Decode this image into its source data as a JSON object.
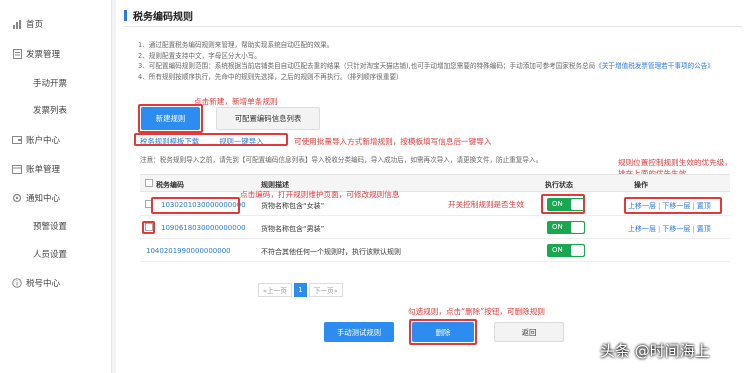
{
  "sidebar": {
    "items": [
      {
        "label": "首页",
        "icon": "bar-chart-icon"
      },
      {
        "label": "发票管理",
        "icon": "document-icon"
      },
      {
        "label": "手动开票"
      },
      {
        "label": "发票列表"
      },
      {
        "label": "账户中心",
        "icon": "wallet-icon"
      },
      {
        "label": "账单管理",
        "icon": "bill-icon"
      },
      {
        "label": "通知中心",
        "icon": "settings-icon"
      },
      {
        "label": "预警设置"
      },
      {
        "label": "人员设置"
      },
      {
        "label": "税号中心",
        "icon": "info-icon"
      }
    ]
  },
  "page": {
    "title": "税务编码规则",
    "notes": [
      "1、通过配置税务编码规则来管理，帮助实现系统自动匹配的效果。",
      "2、规则配置支持中文，字母区分大小写。",
      "3、可配置编码规则范围：系统根据当前店铺类目自动匹配去重的结果（只针对淘宝天猫店铺),也可手动增加您需要的特殊编码；手动添加可参考国家税务总局",
      "《关于增值税发票管理若干事项的公告》",
      "4、所有规则按顺序执行，先命中的规则先选择，之后的规则不再执行。（排列顺序很重要）"
    ],
    "btn_new": "新建规则",
    "btn_config_list": "可配置编码信息列表",
    "link_template": "税务规则模板下载",
    "link_import": "规则一键导入",
    "tip": "注意：税务规则导入之前，请先到【可配置编码信息列表】导入税收分类编码，导入成功后，如需再次导入，请更换文件，防止重复导入。",
    "btn_test": "手动测试规则",
    "btn_delete": "删除",
    "btn_back": "返回"
  },
  "table": {
    "headers": {
      "code": "税务编码",
      "desc": "规则描述",
      "status": "执行状态",
      "ops": "操作"
    },
    "rows": [
      {
        "code": "1030201030000000000",
        "desc": "货物名称包含“女装”",
        "status": "ON",
        "up": "上移一层",
        "down": "下移一层",
        "top": "置顶"
      },
      {
        "code": "1090618030000000000",
        "desc": "货物名称包含“男装”",
        "status": "ON",
        "up": "上移一层",
        "down": "下移一层",
        "top": "置顶"
      },
      {
        "code": "1040201990000000000",
        "desc": "不符合其他任何一个规则时，执行该默认规则",
        "status": "ON"
      }
    ]
  },
  "pager": {
    "prev": "«上一页",
    "current": "1",
    "next": "下一页»"
  },
  "annotations": {
    "new_rule": "点击新建，新增单条规则",
    "batch_import": "可使用批量导入方式新增规则，按模板填写信息后一键导入",
    "click_code": "点击编码，打开规则维护页面，可修改规则信息",
    "toggle_switch": "开关控制规则是否生效",
    "priority_1": "规则位置控制规则生效的优先级，",
    "priority_2": "排在上面的优先生效",
    "delete_tip": "勾选规则，点击“删除”按钮，可删除规则"
  },
  "watermark": "头条 @时间海上",
  "colors": {
    "accent": "#2d8cf0",
    "annotation": "#e23a3a",
    "toggle_on": "#1aa751"
  }
}
